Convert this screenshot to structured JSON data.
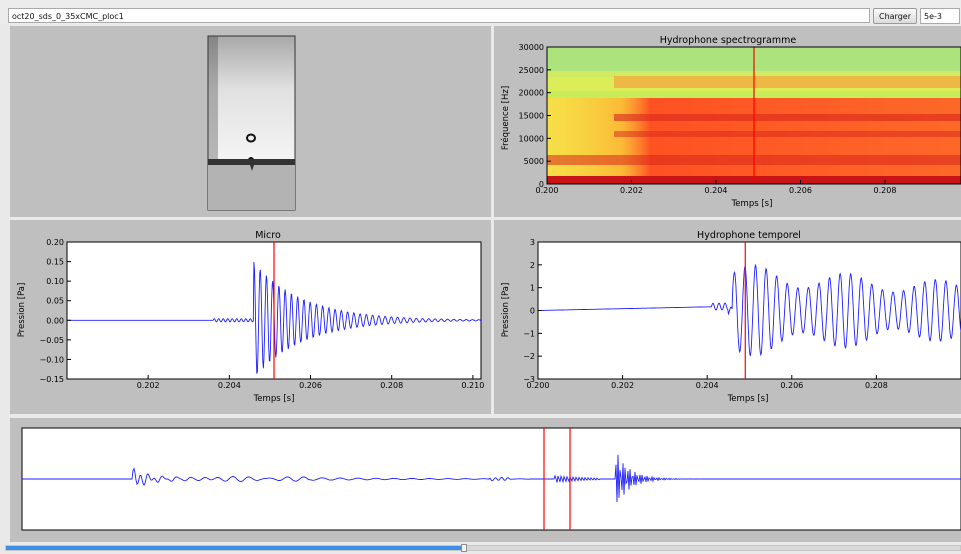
{
  "topbar": {
    "file_value": "oct20_sds_0_35xCMC_ploc1",
    "load_button": "Charger",
    "threshold_value": "5e-3"
  },
  "spectrogram": {
    "title": "Hydrophone spectrogramme",
    "xlabel": "Temps [s]",
    "ylabel": "Fréquence [Hz]",
    "xticks": [
      "0.200",
      "0.202",
      "0.204",
      "0.206",
      "0.208"
    ],
    "yticks": [
      "0",
      "5000",
      "10000",
      "15000",
      "20000",
      "25000",
      "30000"
    ],
    "cursor_time": 0.2049
  },
  "micro": {
    "title": "Micro",
    "xlabel": "Temps [s]",
    "ylabel": "Pression [Pa]",
    "xticks": [
      "0.202",
      "0.204",
      "0.206",
      "0.208",
      "0.210"
    ],
    "yticks": [
      "−0.15",
      "−0.10",
      "−0.05",
      "0.00",
      "0.05",
      "0.10",
      "0.15",
      "0.20"
    ],
    "cursor_time": 0.2051
  },
  "hydro": {
    "title": "Hydrophone temporel",
    "xlabel": "Temps [s]",
    "ylabel": "Pression [Pa]",
    "xticks": [
      "0.200",
      "0.202",
      "0.204",
      "0.206",
      "0.208"
    ],
    "yticks": [
      "−3",
      "−2",
      "−1",
      "0",
      "1",
      "2",
      "3"
    ],
    "cursor_time": 0.2049
  },
  "overview": {
    "selection": "two cursors marking the analysed window"
  },
  "slider": {
    "value_percent": 48
  },
  "colors": {
    "signal": "#1f1fff",
    "cursor": "#ff0000",
    "panel": "#bfbfbf",
    "accent": "#3d8ee8"
  }
}
